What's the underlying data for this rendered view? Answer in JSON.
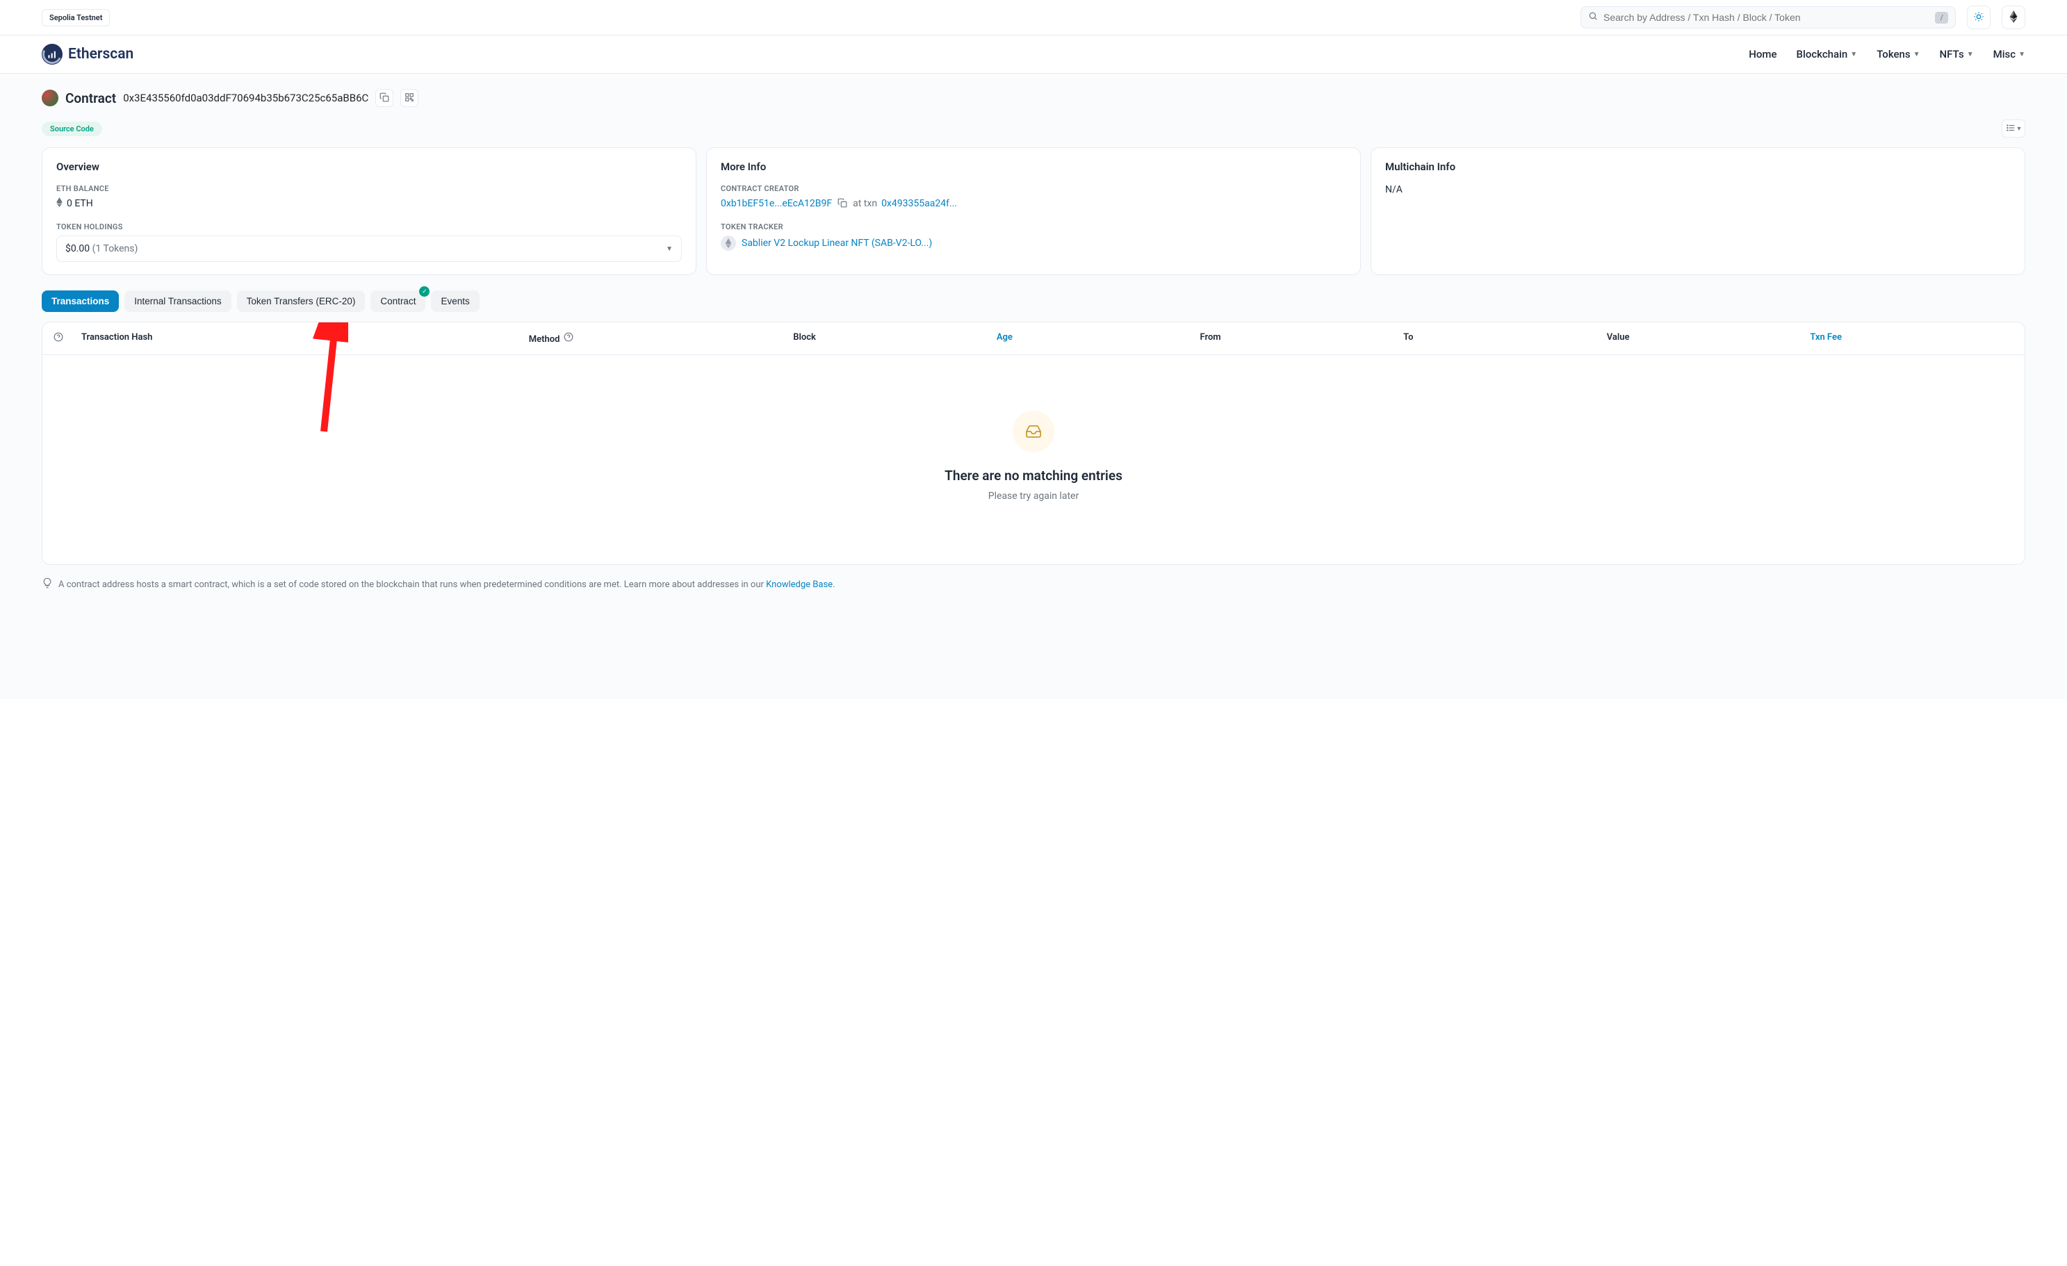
{
  "topbar": {
    "network": "Sepolia Testnet",
    "search_placeholder": "Search by Address / Txn Hash / Block / Token",
    "kbd": "/"
  },
  "brand": {
    "name": "Etherscan"
  },
  "nav": {
    "home": "Home",
    "blockchain": "Blockchain",
    "tokens": "Tokens",
    "nfts": "NFTs",
    "misc": "Misc"
  },
  "header": {
    "title": "Contract",
    "address": "0x3E435560fd0a03ddF70694b35b673C25c65aBB6C"
  },
  "chip": {
    "source_code": "Source Code"
  },
  "cards": {
    "overview": {
      "title": "Overview",
      "eth_balance_label": "ETH BALANCE",
      "eth_balance": "0 ETH",
      "token_holdings_label": "TOKEN HOLDINGS",
      "token_value": "$0.00",
      "token_count": "(1 Tokens)"
    },
    "more_info": {
      "title": "More Info",
      "creator_label": "CONTRACT CREATOR",
      "creator_addr": "0xb1bEF51e...eEcA12B9F",
      "at_txn": "at txn",
      "creator_txn": "0x493355aa24f...",
      "tracker_label": "TOKEN TRACKER",
      "tracker_name": "Sablier V2 Lockup Linear NFT (SAB-V2-LO...)"
    },
    "multichain": {
      "title": "Multichain Info",
      "value": "N/A"
    }
  },
  "tabs": {
    "transactions": "Transactions",
    "internal": "Internal Transactions",
    "token_transfers": "Token Transfers (ERC-20)",
    "contract": "Contract",
    "events": "Events"
  },
  "table": {
    "cols": {
      "txn_hash": "Transaction Hash",
      "method": "Method",
      "block": "Block",
      "age": "Age",
      "from": "From",
      "to": "To",
      "value": "Value",
      "fee": "Txn Fee"
    },
    "empty_title": "There are no matching entries",
    "empty_sub": "Please try again later"
  },
  "tip": {
    "text": "A contract address hosts a smart contract, which is a set of code stored on the blockchain that runs when predetermined conditions are met. Learn more about addresses in our ",
    "link": "Knowledge Base",
    "period": "."
  }
}
